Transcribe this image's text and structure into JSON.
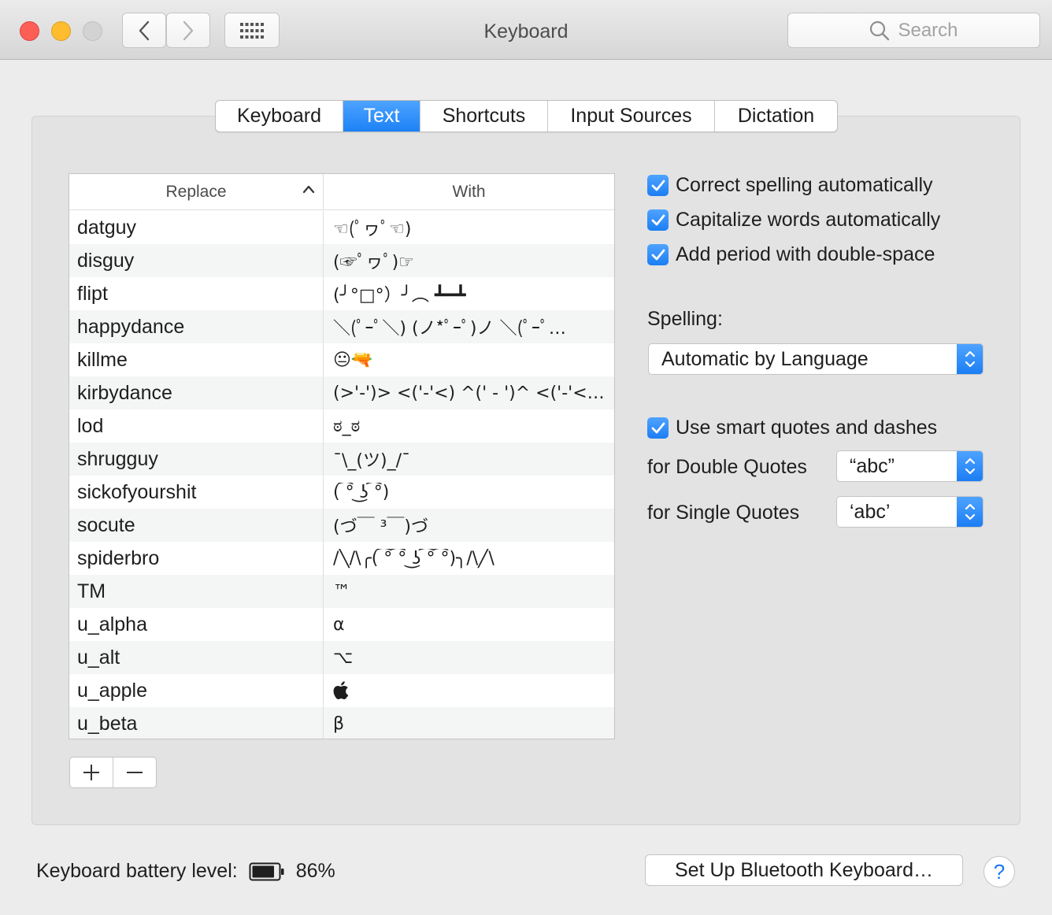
{
  "window": {
    "title": "Keyboard"
  },
  "search": {
    "placeholder": "Search"
  },
  "tabs": [
    {
      "label": "Keyboard",
      "active": false
    },
    {
      "label": "Text",
      "active": true
    },
    {
      "label": "Shortcuts",
      "active": false
    },
    {
      "label": "Input Sources",
      "active": false
    },
    {
      "label": "Dictation",
      "active": false
    }
  ],
  "table": {
    "headers": {
      "replace": "Replace",
      "with": "With"
    },
    "rows": [
      {
        "replace": "datguy",
        "with": "☜(ﾟヮﾟ☜)"
      },
      {
        "replace": "disguy",
        "with": "(☞ﾟヮﾟ)☞"
      },
      {
        "replace": "flipt",
        "with": "(╯°□°）╯︵ ┻━┻"
      },
      {
        "replace": "happydance",
        "with": "＼(ﾟｰﾟ＼) (ノ*ﾟｰﾟ)ノ ＼(ﾟｰﾟ…"
      },
      {
        "replace": "killme",
        "with": "😐🔫"
      },
      {
        "replace": "kirbydance",
        "with": "(>'-')> <('-'<) ^(' - ')^ <('-'<…"
      },
      {
        "replace": "lod",
        "with": "ಠ_ಠ"
      },
      {
        "replace": "shrugguy",
        "with": "¯\\_(ツ)_/¯"
      },
      {
        "replace": "sickofyourshit",
        "with": "( ͡° ͜ʖ ͡°)"
      },
      {
        "replace": "socute",
        "with": "(づ￣ ³￣)づ"
      },
      {
        "replace": "spiderbro",
        "with": "/╲/\\╭( ͡° ͡° ͜ʖ ͡° ͡°)╮/\\╱\\"
      },
      {
        "replace": "TM",
        "with": "™"
      },
      {
        "replace": "u_alpha",
        "with": "α"
      },
      {
        "replace": "u_alt",
        "with": "⌥"
      },
      {
        "replace": "u_apple",
        "with": ""
      },
      {
        "replace": "u_beta",
        "with": "β"
      }
    ]
  },
  "options": {
    "correct_spelling": {
      "label": "Correct spelling automatically",
      "checked": true
    },
    "capitalize": {
      "label": "Capitalize words automatically",
      "checked": true
    },
    "period": {
      "label": "Add period with double-space",
      "checked": true
    },
    "spelling_label": "Spelling:",
    "spelling_value": "Automatic by Language",
    "smart_quotes": {
      "label": "Use smart quotes and dashes",
      "checked": true
    },
    "double_label": "for Double Quotes",
    "double_value": "“abc”",
    "single_label": "for Single Quotes",
    "single_value": "‘abc’"
  },
  "bottom": {
    "battery_label": "Keyboard battery level:",
    "battery_value": "86%",
    "battery_level": 0.86,
    "bluetooth_button": "Set Up Bluetooth Keyboard…",
    "help": "?"
  },
  "colors": {
    "accent": "#1c82f6",
    "close": "#fd5f57",
    "minimize": "#febc2e"
  }
}
